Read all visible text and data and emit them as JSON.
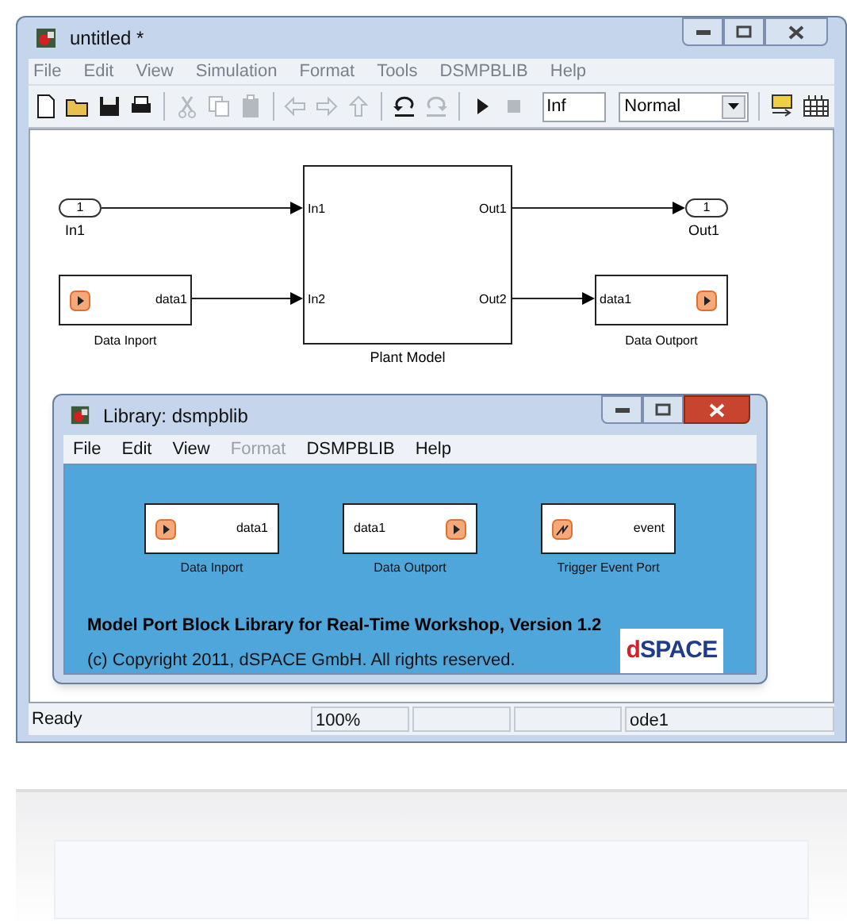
{
  "window": {
    "title": "untitled *"
  },
  "menu": [
    {
      "label": "File"
    },
    {
      "label": "Edit"
    },
    {
      "label": "View"
    },
    {
      "label": "Simulation"
    },
    {
      "label": "Format"
    },
    {
      "label": "Tools"
    },
    {
      "label": "DSMPBLIB"
    },
    {
      "label": "Help"
    }
  ],
  "toolbar": {
    "buttons": [
      {
        "disabled": false
      },
      {
        "disabled": false
      },
      {
        "disabled": false
      },
      {
        "disabled": false
      },
      {
        "disabled": true
      },
      {
        "disabled": true
      },
      {
        "disabled": true
      },
      {
        "disabled": true
      },
      {
        "disabled": true
      },
      {
        "disabled": true
      },
      {
        "disabled": false
      },
      {
        "disabled": true
      },
      {
        "disabled": false
      },
      {
        "disabled": true
      }
    ],
    "stop_time": "Inf",
    "mode": "Normal"
  },
  "model": {
    "inport": {
      "number": "1",
      "label": "In1"
    },
    "outport": {
      "number": "1",
      "label": "Out1"
    },
    "plant": {
      "label": "Plant Model",
      "inputs": [
        "In1",
        "In2"
      ],
      "outputs": [
        "Out1",
        "Out2"
      ]
    },
    "data_inport": {
      "port": "data1",
      "label": "Data Inport"
    },
    "data_outport": {
      "port": "data1",
      "label": "Data Outport"
    }
  },
  "status_bar": [
    "Ready",
    "100%",
    "ode1"
  ],
  "library": {
    "title": "Library: dsmpblib",
    "menu": [
      {
        "label": "File",
        "disabled": false
      },
      {
        "label": "Edit",
        "disabled": false
      },
      {
        "label": "View",
        "disabled": false
      },
      {
        "label": "Format",
        "disabled": true
      },
      {
        "label": "DSMPBLIB",
        "disabled": false
      },
      {
        "label": "Help",
        "disabled": false
      }
    ],
    "blocks": [
      {
        "kind": "out",
        "port": "data1",
        "label": "Data Inport"
      },
      {
        "kind": "in",
        "port": "data1",
        "label": "Data Outport"
      },
      {
        "kind": "event",
        "port": "event",
        "label": "Trigger Event Port"
      }
    ],
    "heading": "Model Port Block Library for Real-Time Workshop, Version 1.2",
    "copyright": "(c) Copyright 2011, dSPACE GmbH. All rights reserved.",
    "logo": "dSPACE"
  }
}
